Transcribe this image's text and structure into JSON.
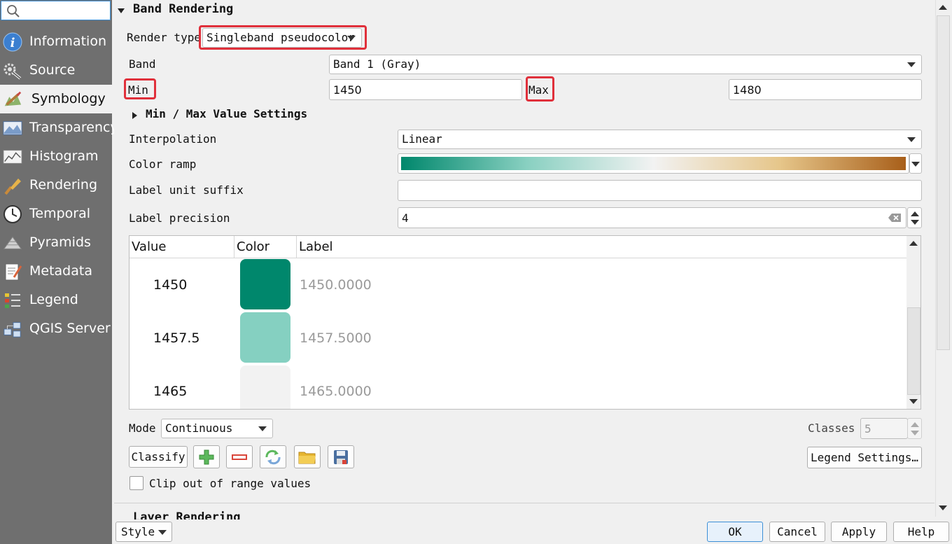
{
  "sidebar": {
    "search_placeholder": "",
    "items": [
      {
        "label": "Information",
        "icon": "info-icon"
      },
      {
        "label": "Source",
        "icon": "source-icon"
      },
      {
        "label": "Symbology",
        "icon": "symbology-icon",
        "active": true
      },
      {
        "label": "Transparency",
        "icon": "transparency-icon"
      },
      {
        "label": "Histogram",
        "icon": "histogram-icon"
      },
      {
        "label": "Rendering",
        "icon": "rendering-icon"
      },
      {
        "label": "Temporal",
        "icon": "temporal-icon"
      },
      {
        "label": "Pyramids",
        "icon": "pyramids-icon"
      },
      {
        "label": "Metadata",
        "icon": "metadata-icon"
      },
      {
        "label": "Legend",
        "icon": "legend-icon"
      },
      {
        "label": "QGIS Server",
        "icon": "qgis-server-icon"
      }
    ]
  },
  "band_rendering": {
    "section_title": "Band Rendering",
    "render_type_label": "Render type",
    "render_type_value": "Singleband pseudocolor",
    "band_label": "Band",
    "band_value": "Band 1 (Gray)",
    "min_label": "Min",
    "min_value": "1450",
    "max_label": "Max",
    "max_value": "1480",
    "minmax_settings_label": "Min / Max Value Settings",
    "interpolation_label": "Interpolation",
    "interpolation_value": "Linear",
    "color_ramp_label": "Color ramp",
    "color_ramp_stops": [
      "#00876c",
      "#89d0c1",
      "#f2f2f2",
      "#e6c68a",
      "#a85f1a"
    ],
    "label_unit_suffix_label": "Label unit suffix",
    "label_unit_suffix_value": "",
    "label_precision_label": "Label precision",
    "label_precision_value": "4",
    "table": {
      "headers": [
        "Value",
        "Color",
        "Label"
      ],
      "rows": [
        {
          "value": "1450",
          "color": "#00876c",
          "label": "1450.0000"
        },
        {
          "value": "1457.5",
          "color": "#85d0c1",
          "label": "1457.5000"
        },
        {
          "value": "1465",
          "color": "#f2f2f2",
          "label": "1465.0000"
        }
      ]
    },
    "mode_label": "Mode",
    "mode_value": "Continuous",
    "classes_label": "Classes",
    "classes_value": "5",
    "classify_label": "Classify",
    "legend_settings_label": "Legend Settings…",
    "clip_label": "Clip out of range values",
    "clip_checked": false,
    "next_section_title": "Layer Rendering"
  },
  "footer": {
    "style_label": "Style",
    "ok_label": "OK",
    "cancel_label": "Cancel",
    "apply_label": "Apply",
    "help_label": "Help"
  },
  "colors": {
    "highlight": "#e0303b",
    "sidebar_bg": "#6f6f6f",
    "accent": "#3c8fd6"
  }
}
